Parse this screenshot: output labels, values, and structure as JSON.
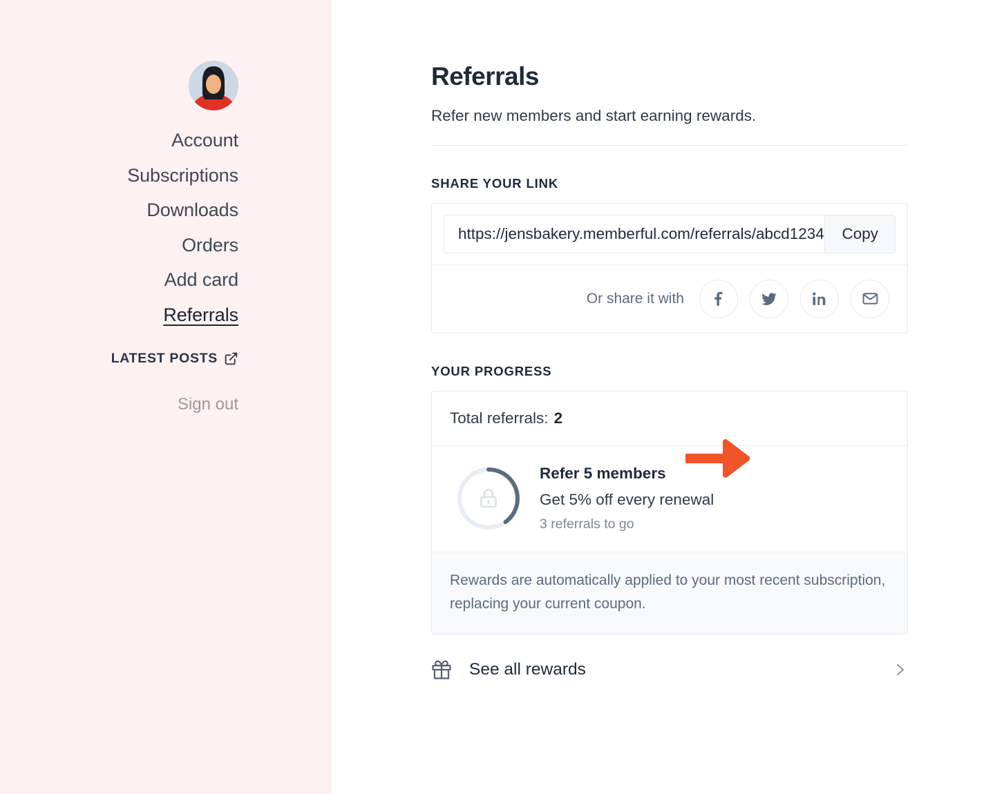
{
  "colors": {
    "sidebar_bg": "#FDF1F2",
    "accent_arrow": "#F0552A",
    "text_dark": "#1E2A3B",
    "text_muted": "#5C6B80",
    "ring_filled": "#5C6B80",
    "ring_track": "#E9EDF3"
  },
  "sidebar": {
    "avatar": {
      "icon": "user-avatar-illustration",
      "alt": "Member avatar"
    },
    "items": [
      {
        "label": "Account",
        "active": false
      },
      {
        "label": "Subscriptions",
        "active": false
      },
      {
        "label": "Downloads",
        "active": false
      },
      {
        "label": "Orders",
        "active": false
      },
      {
        "label": "Add card",
        "active": false
      },
      {
        "label": "Referrals",
        "active": true
      }
    ],
    "latest_posts": {
      "label": "LATEST POSTS",
      "icon": "external-link-icon"
    },
    "sign_out": "Sign out"
  },
  "main": {
    "title": "Referrals",
    "subtitle": "Refer new members and start earning rewards.",
    "share_section": {
      "label": "SHARE YOUR LINK",
      "link_value": "https://jensbakery.memberful.com/referrals/abcd1234",
      "link_placeholder": "Your referral link",
      "copy_label": "Copy",
      "share_with_label": "Or share it with",
      "socials": [
        {
          "name": "facebook-icon",
          "title": "Share on Facebook"
        },
        {
          "name": "twitter-icon",
          "title": "Share on Twitter"
        },
        {
          "name": "linkedin-icon",
          "title": "Share on LinkedIn"
        },
        {
          "name": "email-icon",
          "title": "Share by email"
        }
      ]
    },
    "progress_section": {
      "label": "YOUR PROGRESS",
      "total_label": "Total referrals:",
      "total_value": "2",
      "reward": {
        "icon": "lock-icon",
        "title": "Refer 5 members",
        "description": "Get 5% off every renewal",
        "remaining": "3 referrals to go",
        "progress_percent": 40
      },
      "note": "Rewards are automatically applied to your most recent subscription, replacing your current coupon."
    },
    "see_all_rewards": {
      "icon": "gift-icon",
      "label": "See all rewards",
      "chevron": "chevron-right-icon"
    }
  },
  "annotation": {
    "arrow": "orange-arrow-right",
    "points_at": "Total referrals: 2"
  }
}
